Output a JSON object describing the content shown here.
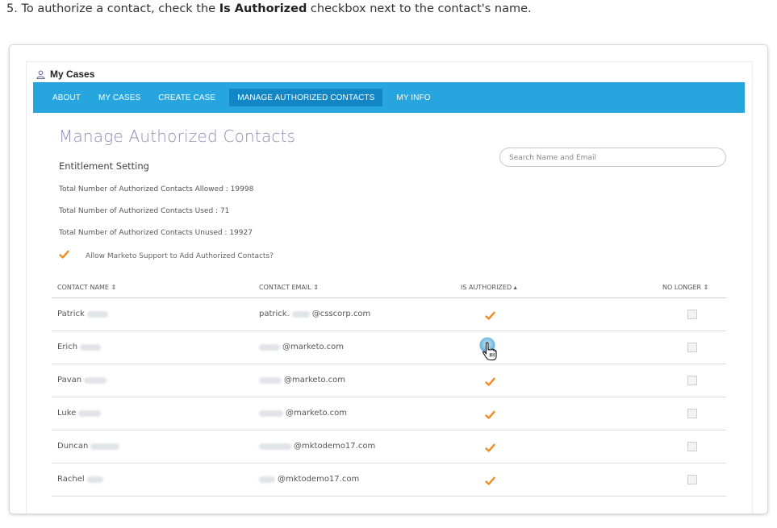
{
  "instruction": {
    "step": "5. To authorize a contact, check the ",
    "bold": "Is Authorized",
    "rest": " checkbox next to the contact's name."
  },
  "header": {
    "title": "My Cases",
    "icon": "user-icon"
  },
  "nav": {
    "items": [
      {
        "label": "ABOUT",
        "active": false
      },
      {
        "label": "MY CASES",
        "active": false
      },
      {
        "label": "CREATE CASE",
        "active": false
      },
      {
        "label": "MANAGE AUTHORIZED CONTACTS",
        "active": true
      },
      {
        "label": "MY INFO",
        "active": false
      }
    ],
    "color": "#27a5de",
    "active_color": "#1386c6"
  },
  "page": {
    "title": "Manage Authorized Contacts",
    "section": "Entitlement Setting",
    "stats": [
      "Total Number of Authorized Contacts Allowed : 19998",
      "Total Number of Authorized Contacts Used : 71",
      "Total Number of Authorized Contacts Unused : 19927"
    ],
    "allow_support_label": "Allow Marketo Support to Add Authorized Contacts?",
    "allow_support_checked": true
  },
  "search": {
    "placeholder": "Search Name and Email",
    "value": ""
  },
  "table": {
    "headers": [
      {
        "label": "CONTACT NAME",
        "sort": "both"
      },
      {
        "label": "CONTACT EMAIL",
        "sort": "both"
      },
      {
        "label": "IS AUTHORIZED",
        "sort": "asc"
      },
      {
        "label": "NO LONGER",
        "sort": "both"
      }
    ],
    "rows": [
      {
        "first_name": "Patrick",
        "email_prefix": "patrick.",
        "email_domain": "@csscorp.com",
        "is_authorized": true,
        "no_longer": false
      },
      {
        "first_name": "Erich",
        "email_prefix": "",
        "email_domain": "@marketo.com",
        "is_authorized": false,
        "no_longer": false,
        "cursor": true
      },
      {
        "first_name": "Pavan",
        "email_prefix": "",
        "email_domain": "@marketo.com",
        "is_authorized": true,
        "no_longer": false
      },
      {
        "first_name": "Luke",
        "email_prefix": "",
        "email_domain": "@marketo.com",
        "is_authorized": true,
        "no_longer": false
      },
      {
        "first_name": "Duncan",
        "email_prefix": "",
        "email_domain": "@mktodemo17.com",
        "is_authorized": true,
        "no_longer": false
      },
      {
        "first_name": "Rachel",
        "email_prefix": "",
        "email_domain": "@mktodemo17.com",
        "is_authorized": true,
        "no_longer": false
      }
    ]
  },
  "colors": {
    "check": "#f08a24",
    "title": "#8d8fb4"
  }
}
